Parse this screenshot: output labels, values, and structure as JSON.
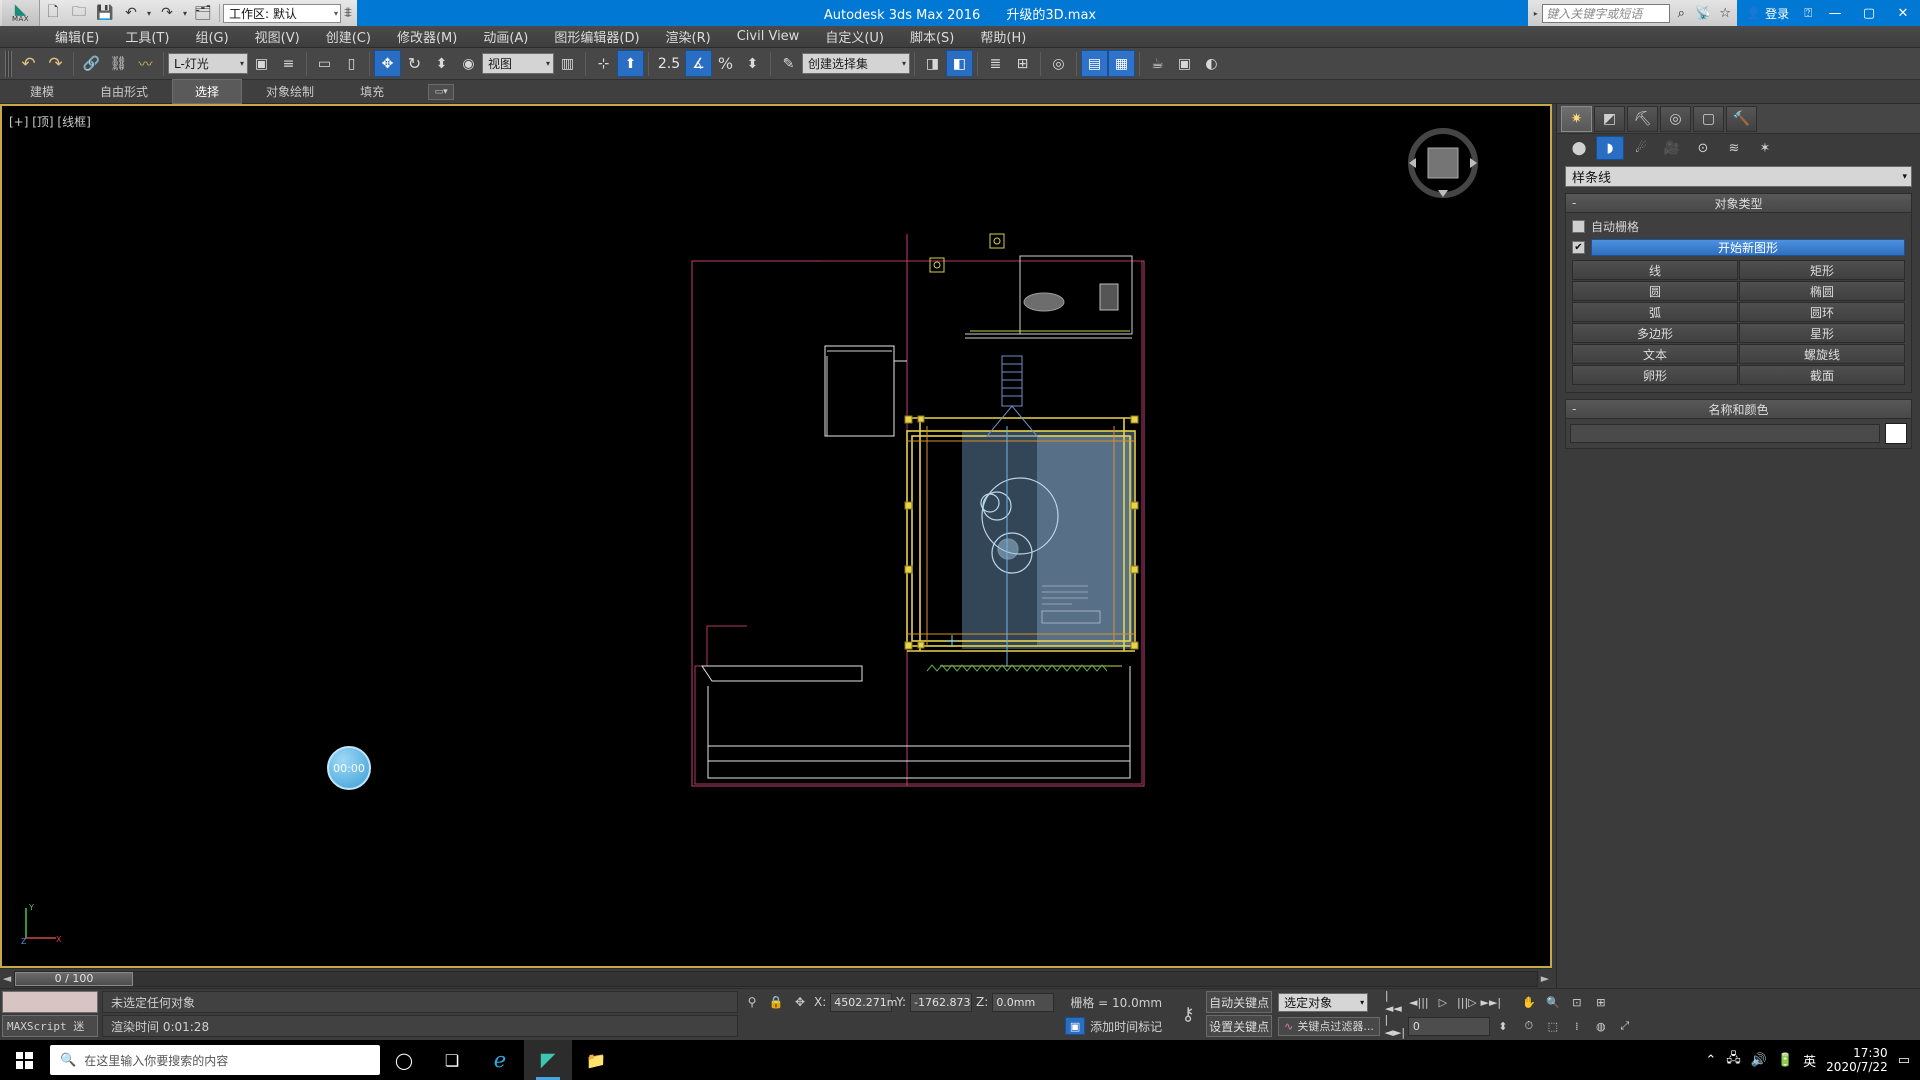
{
  "titlebar": {
    "app_title": "Autodesk 3ds Max 2016",
    "file_name": "升级的3D.max",
    "workspace_label": "工作区: 默认",
    "quick_access": [
      {
        "name": "new-file-icon",
        "glyph": "🗋"
      },
      {
        "name": "open-file-icon",
        "glyph": "🗀"
      },
      {
        "name": "save-file-icon",
        "glyph": "💾"
      },
      {
        "name": "undo-icon",
        "glyph": "↶"
      },
      {
        "name": "redo-icon",
        "glyph": "↷"
      },
      {
        "name": "set-project-icon",
        "glyph": "🗂"
      }
    ],
    "search_placeholder": "键入关键字或短语",
    "infocenter_icons": [
      {
        "name": "search-binoculars-icon",
        "glyph": "⌕"
      },
      {
        "name": "subscription-dish-icon",
        "glyph": "📡"
      },
      {
        "name": "favorites-star-icon",
        "glyph": "☆"
      }
    ],
    "signin_label": "登录",
    "help_label": "?",
    "window_buttons": {
      "minimize": "—",
      "maximize": "▢",
      "close": "✕"
    }
  },
  "menubar": {
    "items": [
      {
        "label": "编辑(E)"
      },
      {
        "label": "工具(T)"
      },
      {
        "label": "组(G)"
      },
      {
        "label": "视图(V)"
      },
      {
        "label": "创建(C)"
      },
      {
        "label": "修改器(M)"
      },
      {
        "label": "动画(A)"
      },
      {
        "label": "图形编辑器(D)"
      },
      {
        "label": "渲染(R)"
      },
      {
        "label": "Civil View"
      },
      {
        "label": "自定义(U)"
      },
      {
        "label": "脚本(S)"
      },
      {
        "label": "帮助(H)"
      }
    ]
  },
  "toolbar": {
    "undo_icon": "↶",
    "redo_icon": "↷",
    "select_link_icon": "🔗",
    "unlink_icon": "⛓",
    "bind_space_warp_icon": "〰",
    "selection_filter": "L-灯光",
    "select_object_icon": "▣",
    "select_by_name_icon": "≡",
    "rect_select_icon": "▭",
    "window_crossing_icon": "▯",
    "select_move_icon": "✥",
    "select_rotate_icon": "↻",
    "select_scale_icon": "⬍",
    "place_icon": "◉",
    "ref_coord_system": "视图",
    "pivot_icon": "▥",
    "snap_toggle_icon": "⊹",
    "align_icon": "⬆",
    "percent_value": "2.5",
    "angle_snap_icon": "∡",
    "percent_snap_icon": "%",
    "spinner_snap_icon": "⬍",
    "edit_named_sets_icon": "✎",
    "named_selection_sets": "创建选择集",
    "mirror_icon": "◨",
    "layers_icon": "◧",
    "curve_editor_icon": "≣",
    "schematic_icon": "⊞",
    "material_editor_icon": "◎",
    "render_setup_icon": "▤",
    "rendered_frame_icon": "▦",
    "render_icon": "☕",
    "render_prod_icon": "▣"
  },
  "ribbon": {
    "tabs": [
      {
        "label": "建模",
        "active": false
      },
      {
        "label": "自由形式",
        "active": false
      },
      {
        "label": "选择",
        "active": true
      },
      {
        "label": "对象绘制",
        "active": false
      },
      {
        "label": "填充",
        "active": false
      }
    ],
    "overflow_icon": "▭▾"
  },
  "viewport": {
    "label": "[+] [顶] [线框]",
    "time_marker": "00:00",
    "axis_labels": {
      "x": "X",
      "y": "Y",
      "z": "Z"
    },
    "viewcube_name": "view-cube"
  },
  "timeslider": {
    "prev_icon": "◄",
    "next_icon": "►",
    "range_label": "0 / 100"
  },
  "command_panel": {
    "tabs": [
      {
        "name": "create-tab",
        "glyph": "✷",
        "active": true
      },
      {
        "name": "modify-tab",
        "glyph": "◩",
        "active": false
      },
      {
        "name": "hierarchy-tab",
        "glyph": "⛏",
        "active": false
      },
      {
        "name": "motion-tab",
        "glyph": "◎",
        "active": false
      },
      {
        "name": "display-tab",
        "glyph": "▢",
        "active": false
      },
      {
        "name": "utilities-tab",
        "glyph": "🔨",
        "active": false
      }
    ],
    "subtabs": [
      {
        "name": "geometry-button",
        "glyph": "⬤",
        "active": false
      },
      {
        "name": "shapes-button",
        "glyph": "◗",
        "active": true
      },
      {
        "name": "lights-button",
        "glyph": "☄",
        "active": false
      },
      {
        "name": "cameras-button",
        "glyph": "🎥",
        "active": false
      },
      {
        "name": "helpers-button",
        "glyph": "⊙",
        "active": false
      },
      {
        "name": "space-warps-button",
        "glyph": "≋",
        "active": false
      },
      {
        "name": "systems-button",
        "glyph": "✶",
        "active": false
      }
    ],
    "category_dropdown": "样条线",
    "object_type": {
      "title": "对象类型",
      "collapse_icon": "-",
      "autogrid_label": "自动栅格",
      "autogrid_checked": false,
      "start_new_shape_label": "开始新图形",
      "start_new_shape_checked": true,
      "buttons": [
        "线",
        "矩形",
        "圆",
        "椭圆",
        "弧",
        "圆环",
        "多边形",
        "星形",
        "文本",
        "螺旋线",
        "卵形",
        "截面"
      ]
    },
    "name_and_color": {
      "title": "名称和颜色",
      "collapse_icon": "-",
      "name_value": "",
      "color_hex": "#ffffff"
    }
  },
  "statusbar": {
    "maxscript_label": "MAXScript 迷",
    "selection_status": "未选定任何对象",
    "render_time": "渲染时间 0:01:28",
    "coords": {
      "x_label": "X:",
      "x_value": "4502.271m",
      "y_label": "Y:",
      "y_value": "-1762.873",
      "z_label": "Z:",
      "z_value": "0.0mm"
    },
    "grid_label": "栅格 = 10.0mm",
    "add_time_tag": "添加时间标记",
    "auto_key_label": "自动关键点",
    "set_key_label": "设置关键点",
    "key_filters_label": "关键点过滤器...",
    "selected_object_label": "选定对象",
    "frame_value": "0",
    "key_icon": "⚷",
    "nav_icons": [
      {
        "name": "go-to-start-icon",
        "glyph": "|◄◄"
      },
      {
        "name": "previous-frame-icon",
        "glyph": "◄|||"
      },
      {
        "name": "play-animation-icon",
        "glyph": "▷"
      },
      {
        "name": "next-frame-icon",
        "glyph": "|||▷"
      },
      {
        "name": "go-to-end-icon",
        "glyph": "►►|"
      }
    ],
    "view_icons": [
      {
        "name": "pan-view-icon",
        "glyph": "✋"
      },
      {
        "name": "zoom-view-icon",
        "glyph": "🔍"
      },
      {
        "name": "zoom-extents-icon",
        "glyph": "⊡"
      },
      {
        "name": "maximize-viewport-icon",
        "glyph": "⊞"
      }
    ]
  },
  "taskbar": {
    "search_placeholder": "在这里输入你要搜索的内容",
    "search_icon": "🔍",
    "apps": [
      {
        "name": "cortana-button",
        "glyph": "◯"
      },
      {
        "name": "task-view-button",
        "glyph": "❏"
      },
      {
        "name": "edge-button",
        "glyph": "ℯ"
      },
      {
        "name": "3dsmax-button",
        "glyph": "◤"
      },
      {
        "name": "explorer-button",
        "glyph": "📁"
      }
    ],
    "tray": [
      {
        "name": "show-hidden-icons",
        "glyph": "⌃"
      },
      {
        "name": "network-icon",
        "glyph": "🖧"
      },
      {
        "name": "volume-icon",
        "glyph": "🔊"
      },
      {
        "name": "battery-icon",
        "glyph": "🔋"
      },
      {
        "name": "ime-icon",
        "glyph": "英"
      }
    ],
    "clock_time": "17:30",
    "clock_date": "2020/7/22"
  }
}
